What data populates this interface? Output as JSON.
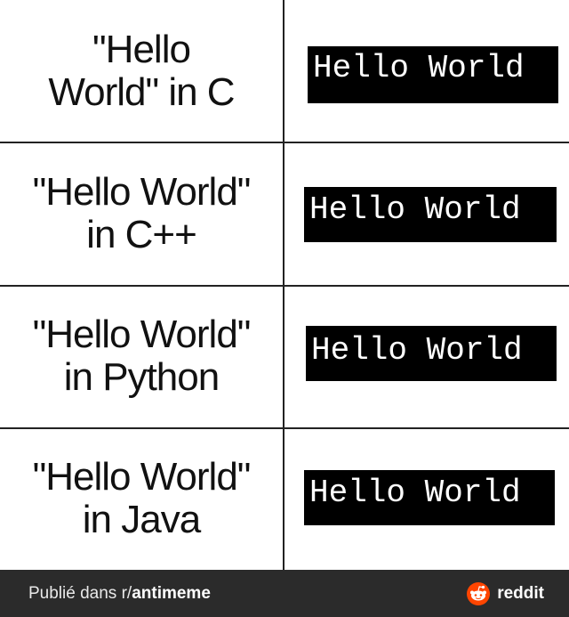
{
  "panels": [
    {
      "label_lines": [
        "\"Hello",
        "World\" in C"
      ],
      "output": "Hello World"
    },
    {
      "label_lines": [
        "\"Hello World\"",
        "in C++"
      ],
      "output": "Hello World"
    },
    {
      "label_lines": [
        "\"Hello World\"",
        "in Python"
      ],
      "output": "Hello World"
    },
    {
      "label_lines": [
        "\"Hello World\"",
        "in Java"
      ],
      "output": "Hello World"
    }
  ],
  "footer": {
    "prefix": "Publié dans r/",
    "subreddit": "antimeme",
    "brand": "reddit",
    "brand_color": "#ff4500"
  },
  "icons": {
    "brand_icon": "reddit-alien-icon"
  }
}
